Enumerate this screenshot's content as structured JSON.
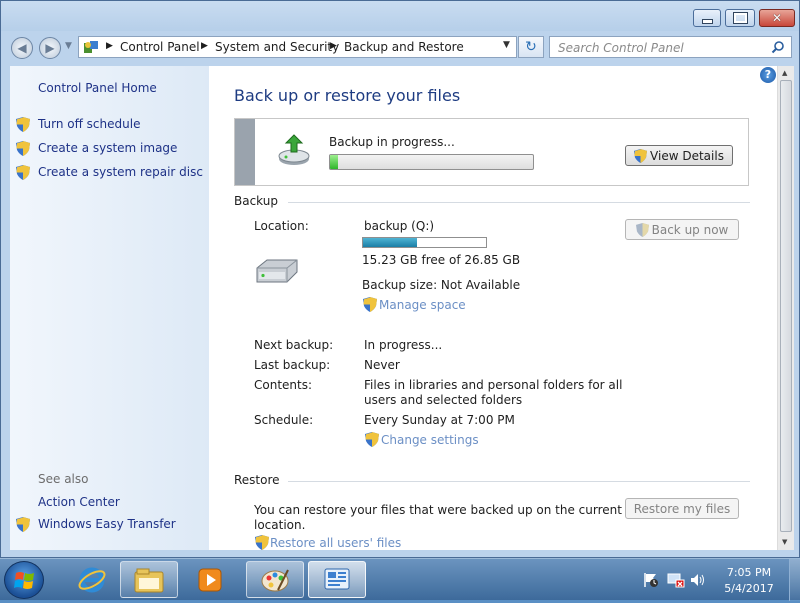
{
  "window": {
    "caption_buttons": {
      "minimize": "minimize-icon",
      "maximize": "maximize-icon",
      "close": "✕"
    }
  },
  "navbar": {
    "breadcrumbs": [
      "Control Panel",
      "System and Security",
      "Backup and Restore"
    ],
    "search_placeholder": "Search Control Panel"
  },
  "sidebar": {
    "home": "Control Panel Home",
    "tasks": [
      "Turn off schedule",
      "Create a system image",
      "Create a system repair disc"
    ],
    "see_also_title": "See also",
    "see_also": [
      "Action Center",
      "Windows Easy Transfer"
    ]
  },
  "main": {
    "title": "Back up or restore your files",
    "progress": {
      "status": "Backup in progress...",
      "fraction": 0.04,
      "button": "View Details"
    },
    "backup": {
      "heading": "Backup",
      "location_label": "Location:",
      "location_value": "backup (Q:)",
      "drive_used_fraction": 0.44,
      "free_space": "15.23 GB free of 26.85 GB",
      "backup_size": "Backup size: Not Available",
      "manage_space": "Manage space",
      "back_up_now": "Back up now",
      "next_label": "Next backup:",
      "next_value": "In progress...",
      "last_label": "Last backup:",
      "last_value": "Never",
      "contents_label": "Contents:",
      "contents_line1": "Files in libraries and personal folders for all",
      "contents_line2": "users and selected folders",
      "schedule_label": "Schedule:",
      "schedule_value": "Every Sunday at 7:00 PM",
      "change_settings": "Change settings"
    },
    "restore": {
      "heading": "Restore",
      "text_line1": "You can restore your files that were backed up on the current",
      "text_line2": "location.",
      "restore_button": "Restore my files",
      "restore_all": "Restore all users' files"
    }
  },
  "taskbar": {
    "items": [
      "windows-explorer-icon",
      "internet-explorer-icon",
      "media-player-icon",
      "paint-icon",
      "control-panel-icon"
    ],
    "time": "7:05 PM",
    "date": "5/4/2017"
  },
  "colors": {
    "link": "#1e3287",
    "title": "#1e3c82",
    "progress_green": "#2fb52a",
    "drive_bar": "#1a7ea6"
  }
}
